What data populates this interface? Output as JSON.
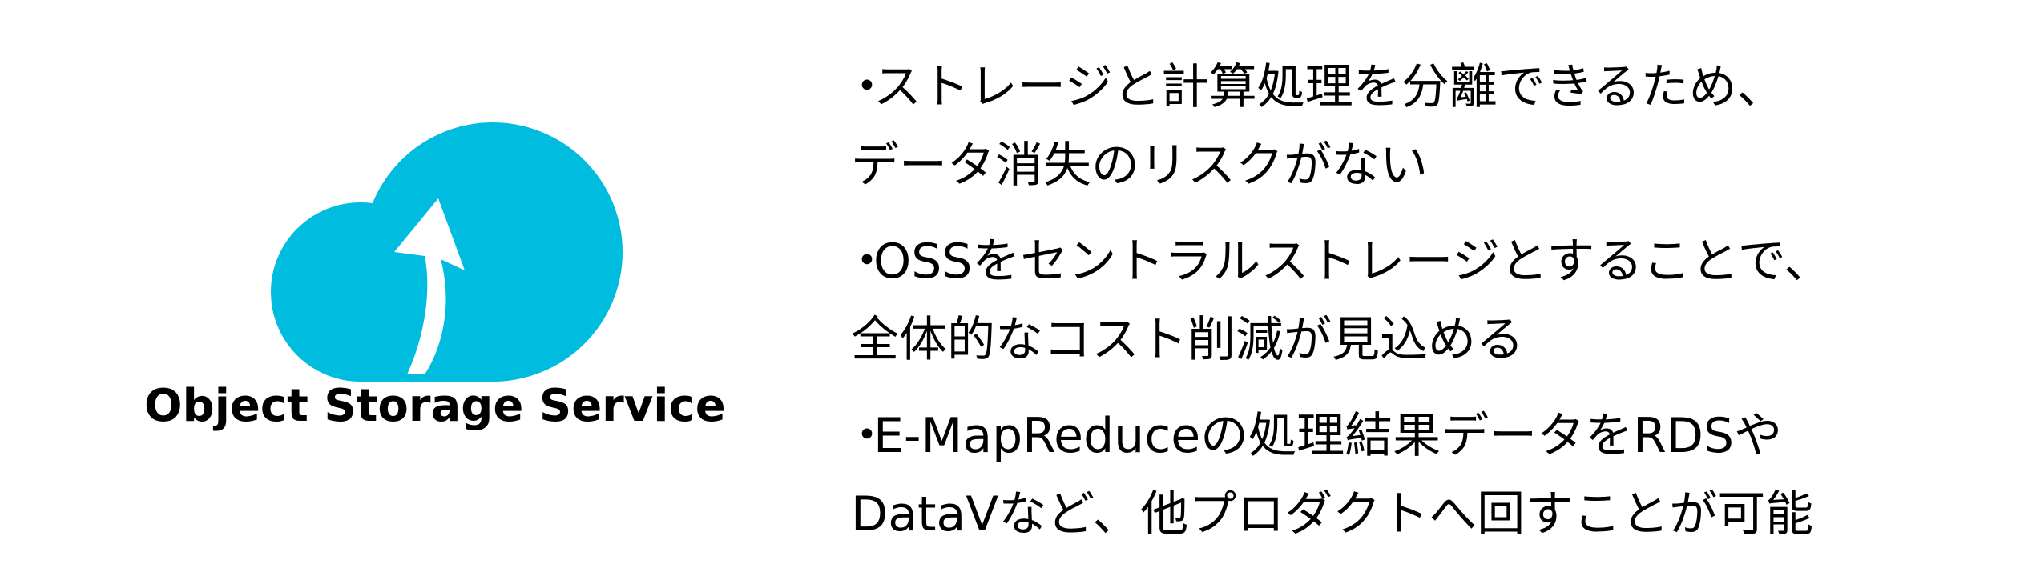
{
  "logo": {
    "icon": "cloud-upload-icon",
    "color": "#00bcdf",
    "name": "Object Storage Service"
  },
  "bullet_marker": "・",
  "bullets": [
    {
      "line1": "ストレージと計算処理を分離できるため、",
      "line2": "データ消失のリスクがない"
    },
    {
      "line1": "OSSをセントラルストレージとすることで、",
      "line2": "全体的なコスト削減が見込める"
    },
    {
      "line1": "E-MapReduceの処理結果データをRDSや",
      "line2": "DataVなど、他プロダクトへ回すことが可能"
    }
  ]
}
